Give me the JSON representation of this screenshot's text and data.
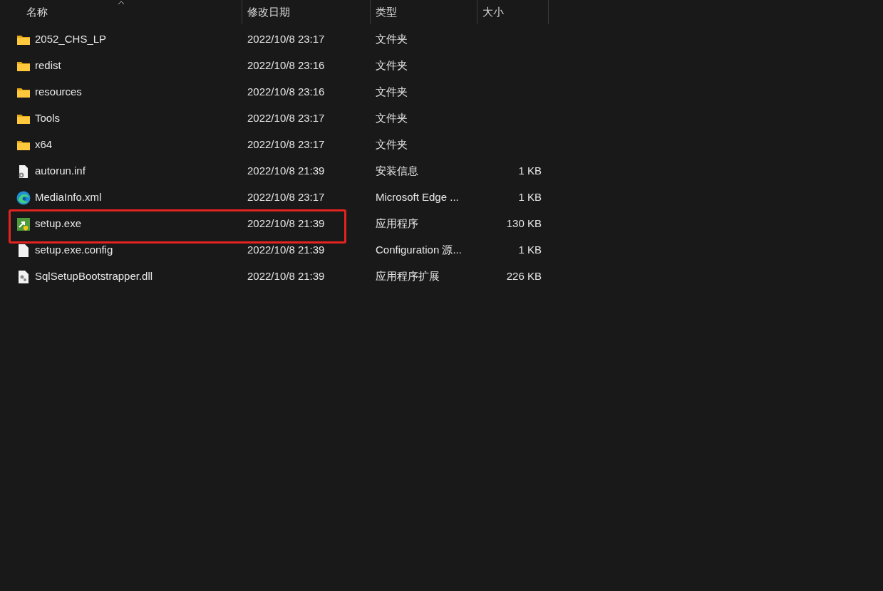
{
  "columns": [
    {
      "label": "名称",
      "sorted": true
    },
    {
      "label": "修改日期",
      "sorted": false
    },
    {
      "label": "类型",
      "sorted": false
    },
    {
      "label": "大小",
      "sorted": false
    }
  ],
  "rows": [
    {
      "kind": "folder",
      "name": "2052_CHS_LP",
      "date": "2022/10/8 23:17",
      "type": "文件夹",
      "highlighted": false
    },
    {
      "kind": "folder",
      "name": "redist",
      "date": "2022/10/8 23:16",
      "type": "文件夹",
      "highlighted": false
    },
    {
      "kind": "folder",
      "name": "resources",
      "date": "2022/10/8 23:16",
      "type": "文件夹",
      "highlighted": false
    },
    {
      "kind": "folder",
      "name": "Tools",
      "date": "2022/10/8 23:17",
      "type": "文件夹",
      "highlighted": false
    },
    {
      "kind": "folder",
      "name": "x64",
      "date": "2022/10/8 23:17",
      "type": "文件夹",
      "highlighted": false
    },
    {
      "kind": "settings",
      "name": "autorun.inf",
      "date": "2022/10/8 21:39",
      "type": "安装信息",
      "size": "1 KB",
      "highlighted": false
    },
    {
      "kind": "edge",
      "name": "MediaInfo.xml",
      "date": "2022/10/8 23:17",
      "type": "Microsoft Edge ...",
      "size": "1 KB",
      "highlighted": false
    },
    {
      "kind": "exe",
      "name": "setup.exe",
      "date": "2022/10/8 21:39",
      "type": "应用程序",
      "size": "130 KB",
      "highlighted": true
    },
    {
      "kind": "file",
      "name": "setup.exe.config",
      "date": "2022/10/8 21:39",
      "type": "Configuration 源...",
      "size": "1 KB",
      "highlighted": false
    },
    {
      "kind": "dll",
      "name": "SqlSetupBootstrapper.dll",
      "date": "2022/10/8 21:39",
      "type": "应用程序扩展",
      "size": "226 KB",
      "highlighted": false
    }
  ]
}
